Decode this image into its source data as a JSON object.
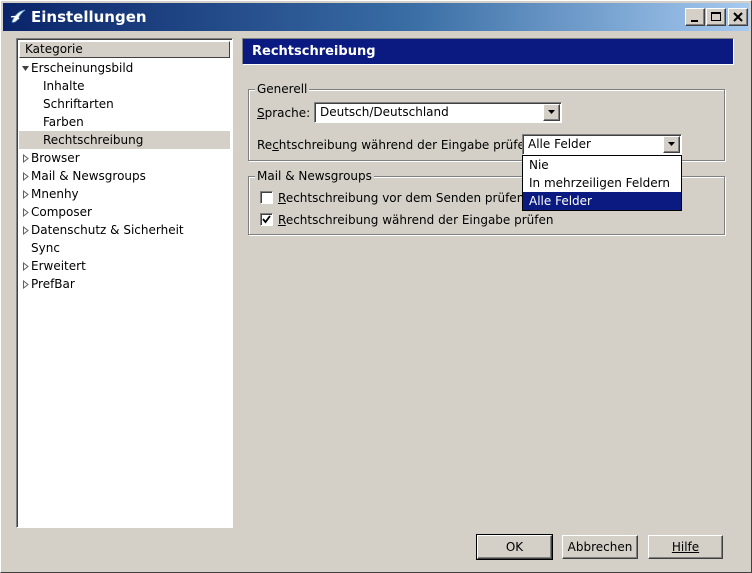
{
  "window": {
    "title": "Einstellungen"
  },
  "tree": {
    "header": "Kategorie",
    "items": [
      {
        "label": "Erscheinungsbild",
        "level": 0,
        "twisty": "expanded"
      },
      {
        "label": "Inhalte",
        "level": 1,
        "twisty": "none"
      },
      {
        "label": "Schriftarten",
        "level": 1,
        "twisty": "none"
      },
      {
        "label": "Farben",
        "level": 1,
        "twisty": "none"
      },
      {
        "label": "Rechtschreibung",
        "level": 1,
        "twisty": "none",
        "selected": true
      },
      {
        "label": "Browser",
        "level": 0,
        "twisty": "collapsed"
      },
      {
        "label": "Mail & Newsgroups",
        "level": 0,
        "twisty": "collapsed"
      },
      {
        "label": "Mnenhy",
        "level": 0,
        "twisty": "collapsed"
      },
      {
        "label": "Composer",
        "level": 0,
        "twisty": "collapsed"
      },
      {
        "label": "Datenschutz & Sicherheit",
        "level": 0,
        "twisty": "collapsed"
      },
      {
        "label": "Sync",
        "level": 0,
        "twisty": "none"
      },
      {
        "label": "Erweitert",
        "level": 0,
        "twisty": "collapsed"
      },
      {
        "label": "PrefBar",
        "level": 0,
        "twisty": "collapsed"
      }
    ]
  },
  "page": {
    "title": "Rechtschreibung",
    "generell": {
      "title": "Generell",
      "sprache_label_key": "S",
      "sprache_label_rest": "prache:",
      "sprache_value": "Deutsch/Deutschland",
      "check_label_pre": "Re",
      "check_label_key": "c",
      "check_label_rest": "htschreibung während der Eingabe prüfen:",
      "check_value": "Alle Felder",
      "check_options": [
        "Nie",
        "In mehrzeiligen Feldern",
        "Alle Felder"
      ],
      "check_selected_index": 2
    },
    "mail": {
      "title": "Mail & Newsgroups",
      "before_send_key": "R",
      "before_send_rest": "echtschreibung vor dem Senden prüfen",
      "before_send_checked": false,
      "while_typing_key": "R",
      "while_typing_rest": "echtschreibung während der Eingabe prüfen",
      "while_typing_checked": true
    }
  },
  "buttons": {
    "ok": "OK",
    "cancel": "Abbrechen",
    "help": "Hilfe"
  },
  "icons": {
    "app": "seamonkey-icon",
    "minimize": "minimize-icon",
    "maximize": "maximize-icon",
    "close": "close-icon"
  },
  "colors": {
    "titlebar_start": "#0a246a",
    "titlebar_end": "#a6caf0",
    "header_bg": "#0a1a80",
    "face": "#d4d0c8"
  }
}
